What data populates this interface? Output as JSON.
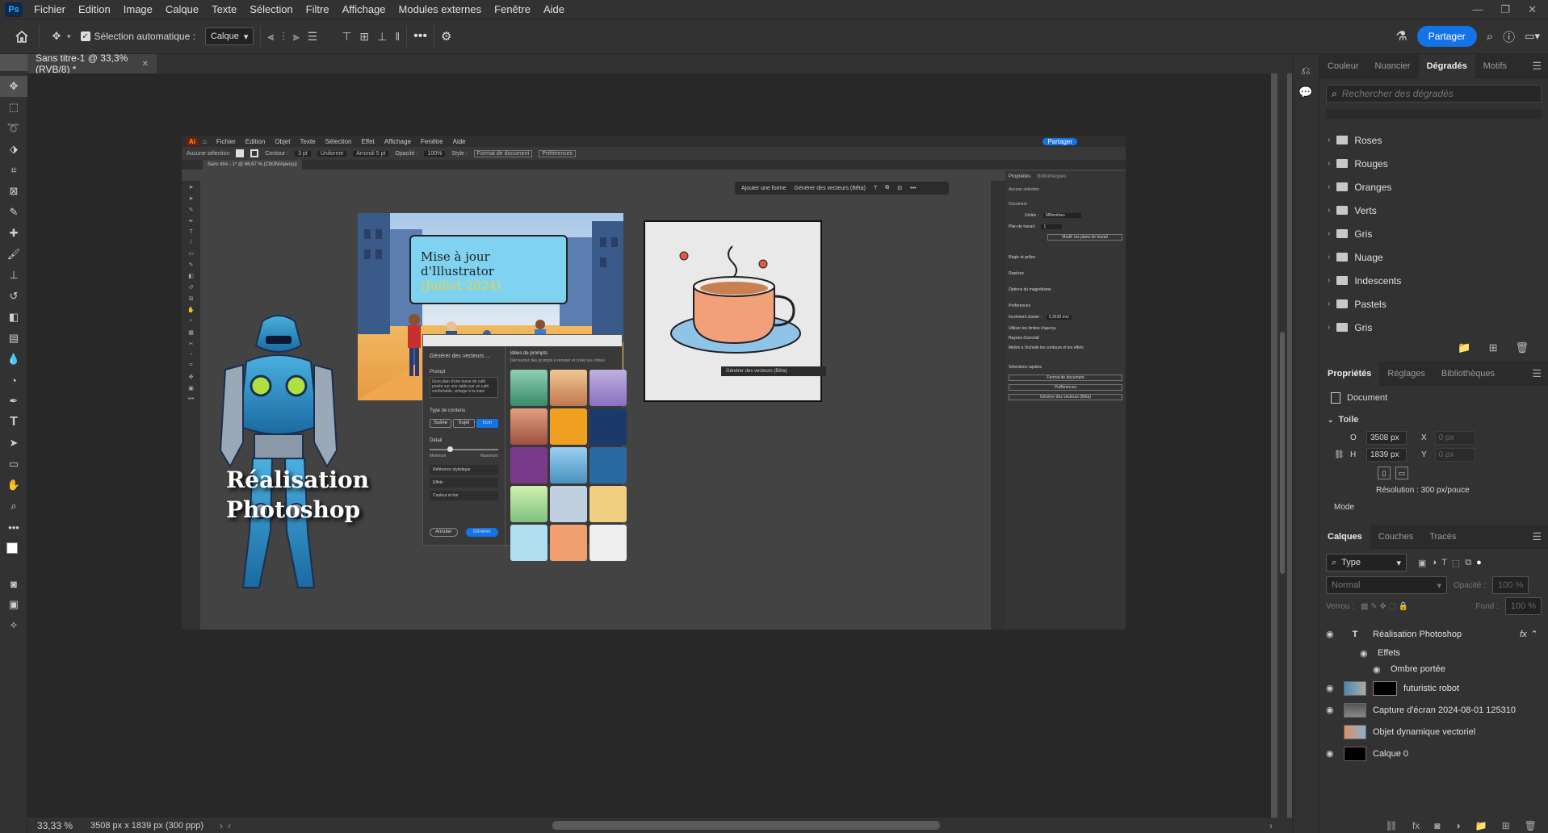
{
  "app": {
    "logo": "Ps"
  },
  "menu": [
    "Fichier",
    "Edition",
    "Image",
    "Calque",
    "Texte",
    "Sélection",
    "Filtre",
    "Affichage",
    "Modules externes",
    "Fenêtre",
    "Aide"
  ],
  "options": {
    "auto_select_label": "Sélection automatique :",
    "auto_select_value": "Calque",
    "share": "Partager"
  },
  "doc_tab": {
    "title": "Sans titre-1 @ 33,3% (RVB/8) *"
  },
  "status": {
    "zoom": "33,33 %",
    "doc_info": "3508 px x 1839 px (300 ppp)"
  },
  "gradients_panel": {
    "tabs": [
      "Couleur",
      "Nuancier",
      "Dégradés",
      "Motifs"
    ],
    "active_tab": "Dégradés",
    "search_placeholder": "Rechercher des dégradés",
    "folders": [
      "Roses",
      "Rouges",
      "Oranges",
      "Verts",
      "Gris",
      "Nuage",
      "Indescents",
      "Pastels",
      "Gris"
    ]
  },
  "properties_panel": {
    "tabs": [
      "Propriétés",
      "Réglages",
      "Bibliothèques"
    ],
    "active_tab": "Propriétés",
    "doc_label": "Document",
    "section": "Toile",
    "w_label": "O",
    "w_value": "3508 px",
    "h_label": "H",
    "h_value": "1839 px",
    "x_label": "X",
    "x_value": "0 px",
    "y_label": "Y",
    "y_value": "0 px",
    "resolution": "Résolution : 300 px/pouce",
    "mode": "Mode"
  },
  "layers_panel": {
    "tabs": [
      "Calques",
      "Couches",
      "Tracés"
    ],
    "active_tab": "Calques",
    "filter": "Type",
    "blend": "Normal",
    "opacity_label": "Opacité :",
    "opacity_value": "100 %",
    "lock_label": "Verrou :",
    "fill_label": "Fond :",
    "fill_value": "100 %",
    "layers": [
      {
        "name": "Réalisation Photoshop",
        "kind": "text",
        "visible": true
      },
      {
        "name": "Effets",
        "kind": "effects",
        "visible": true
      },
      {
        "name": "Ombre portée",
        "kind": "effect",
        "visible": true
      },
      {
        "name": "futuristic robot",
        "kind": "masked",
        "visible": true
      },
      {
        "name": "Capture d'écran 2024-08-01 125310",
        "kind": "image",
        "visible": true
      },
      {
        "name": "Objet dynamique vectoriel",
        "kind": "smart",
        "visible": false
      },
      {
        "name": "Calque 0",
        "kind": "black",
        "visible": true
      }
    ]
  },
  "canvas": {
    "overlay_text": "Réalisation\nPhotoshop"
  },
  "inner": {
    "menu": [
      "Fichier",
      "Edition",
      "Objet",
      "Texte",
      "Sélection",
      "Effet",
      "Affichage",
      "Fenêtre",
      "Aide"
    ],
    "share": "Partager",
    "options": [
      "Aucune sélection",
      "Contour :",
      "3 pt",
      "Uniforme",
      "Arrondi 5 pt",
      "Opacité :",
      "100%",
      "Style :",
      "Format de document",
      "Préférences"
    ],
    "doc_tab": "Sans titre - 1* @ 66,67 % (CMJN/Aperçu)",
    "ctx_bar": [
      "Ajouter une forme",
      "Générer des vecteurs (Bêta)"
    ],
    "card_title": "Mise à jour d'Illustrator",
    "card_subtitle": "(Juillet 2024)",
    "gen_panel": {
      "title": "Générer des vecteurs ...",
      "prompt_label": "Prompt",
      "prompt_text": "Gros plan d'une tasse de café posée sur une table par un café confortable, vintage à la main",
      "type_label": "Type de contenu",
      "types": [
        "Scène",
        "Sujet",
        "Icon"
      ],
      "detail_label": "Détail",
      "min": "Minimum",
      "max": "Maximum",
      "rows": [
        "Référence stylistique",
        "Effets",
        "Couleur et ton"
      ],
      "cancel": "Annuler",
      "generate": "Générer",
      "ideas_title": "Idées de prompts",
      "ideas_sub": "Découvrez des prompts à remixer et créez les vôtres"
    },
    "props": {
      "tabs": [
        "Propriétés",
        "Bibliothèques"
      ],
      "no_sel": "Aucune sélection",
      "doc": "Document",
      "units_label": "Unités :",
      "units": "Millimètres",
      "artboard_label": "Plan de travail :",
      "artboard": "1",
      "edit_ab": "Modif. les plans de travail",
      "rulers": "Règle et grilles",
      "guides": "Repères",
      "snap": "Options du magnétisme",
      "prefs": "Préférences",
      "key_inc_label": "Incrément clavier :",
      "key_inc": "0,3528 mm",
      "opts": [
        "Utiliser les limites d'aperçu",
        "Rayons d'arrondi",
        "Mettre à l'échelle les contours et les effets"
      ],
      "quick": "Sélections rapides",
      "quick_btns": [
        "Format de document",
        "Préférences",
        "Générer des vecteurs (Bêta)"
      ]
    },
    "popup_label": "Générer des vecteurs (Bêta)"
  },
  "colors": {
    "accent": "#1473e6",
    "ps_bg": "#323232"
  }
}
